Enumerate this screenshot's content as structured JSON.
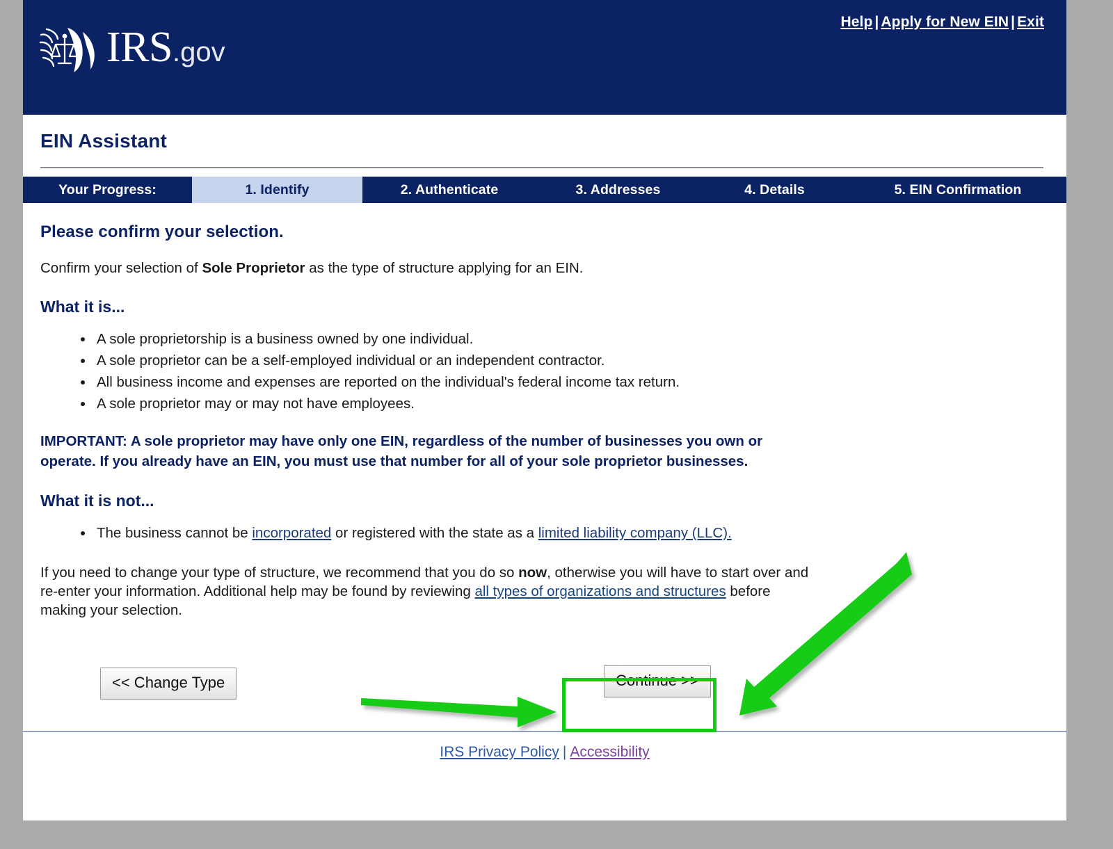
{
  "masthead": {
    "logo_text": "IRS",
    "logo_suffix": ".gov",
    "logo_icon": "irs-eagle-scales-seal",
    "util_links": [
      {
        "label": "Help",
        "name": "help-link"
      },
      {
        "label": "Apply for New EIN",
        "name": "apply-new-ein-link"
      },
      {
        "label": "Exit",
        "name": "exit-link"
      }
    ],
    "separator": "|",
    "bg_color": "#0b2265"
  },
  "app": {
    "title": "EIN Assistant"
  },
  "progress": {
    "label": "Your Progress:",
    "current_index": 1,
    "active_bg": "#c5d3ec",
    "bar_bg": "#0b2265",
    "steps": [
      {
        "label": "1. Identify"
      },
      {
        "label": "2. Authenticate"
      },
      {
        "label": "3. Addresses"
      },
      {
        "label": "4. Details"
      },
      {
        "label": "5. EIN Confirmation"
      }
    ]
  },
  "main": {
    "heading": "Please confirm your selection.",
    "confirm_pre": "Confirm your selection of ",
    "confirm_entity": "Sole Proprietor",
    "confirm_post": " as the type of structure applying for an EIN.",
    "what_it_is_heading": "What it is...",
    "what_it_is_bullets": [
      "A sole proprietorship is a business owned by one individual.",
      "A sole proprietor can be a self-employed individual or an independent contractor.",
      "All business income and expenses are reported on the individual's federal income tax return.",
      "A sole proprietor may or may not have employees."
    ],
    "important_text": "IMPORTANT: A sole proprietor may have only one EIN, regardless of the number of businesses you own or operate. If you already have an EIN, you must use that number for all of your sole proprietor businesses.",
    "what_it_is_not_heading": "What it is not...",
    "not_bullet_pre": "The business cannot be ",
    "not_bullet_link1": "incorporated",
    "not_bullet_mid": " or registered with the state as a ",
    "not_bullet_link2": "limited liability company (LLC).",
    "closing_pre": "If you need to change your type of structure, we recommend that you do so ",
    "closing_bold": "now",
    "closing_mid": ", otherwise you will have to start over and re-enter your information.  Additional help may be found by reviewing ",
    "closing_link": "all types of organizations and structures",
    "closing_post": " before making your selection."
  },
  "buttons": {
    "change_type": "<< Change Type",
    "continue": "Continue >>"
  },
  "footer": {
    "privacy": "IRS Privacy Policy",
    "separator": "|",
    "accessibility": "Accessibility"
  },
  "annotations": {
    "color": "#15cc15",
    "highlight_target": "continue-button",
    "arrows": [
      {
        "name": "annotation-arrow-horizontal",
        "points_to": "continue-button"
      },
      {
        "name": "annotation-arrow-diagonal",
        "points_to": "continue-button"
      }
    ]
  }
}
